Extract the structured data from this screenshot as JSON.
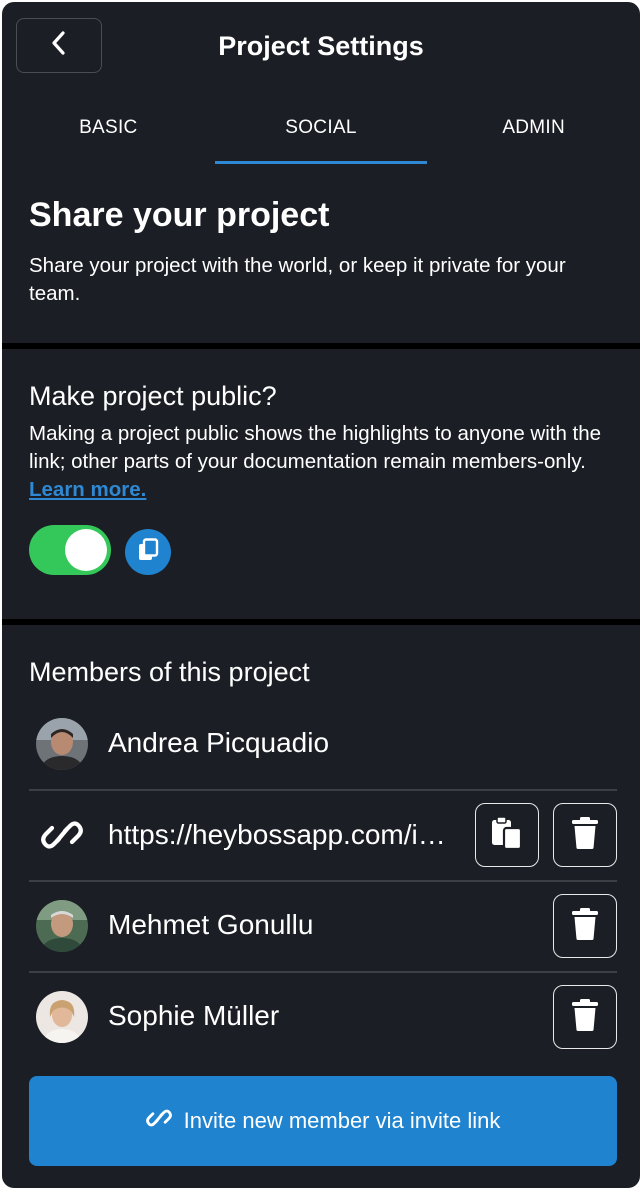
{
  "header": {
    "title": "Project Settings",
    "back_icon": "chevron-left-icon"
  },
  "tabs": [
    {
      "label": "BASIC",
      "active": false
    },
    {
      "label": "SOCIAL",
      "active": true
    },
    {
      "label": "ADMIN",
      "active": false
    }
  ],
  "share": {
    "title": "Share your project",
    "description": "Share your project with the world, or keep it private for your team."
  },
  "public": {
    "title": "Make project public?",
    "description": "Making a project public shows the highlights to anyone with the link; other parts of your documentation remain members-only.",
    "learn_more": "Learn more.",
    "toggle_on": true
  },
  "members": {
    "title": "Members of this project",
    "owner": {
      "name": "Andrea Picquadio"
    },
    "invite_link": {
      "url": "https://heybossapp.com/invite"
    },
    "list": [
      {
        "name": "Mehmet Gonullu"
      },
      {
        "name": "Sophie Müller"
      }
    ]
  },
  "invite_button": {
    "label": "Invite new member via invite link"
  },
  "colors": {
    "background": "#1b1e24",
    "accent": "#1f83cf",
    "toggle_on": "#34c759",
    "link": "#2f88d3"
  }
}
